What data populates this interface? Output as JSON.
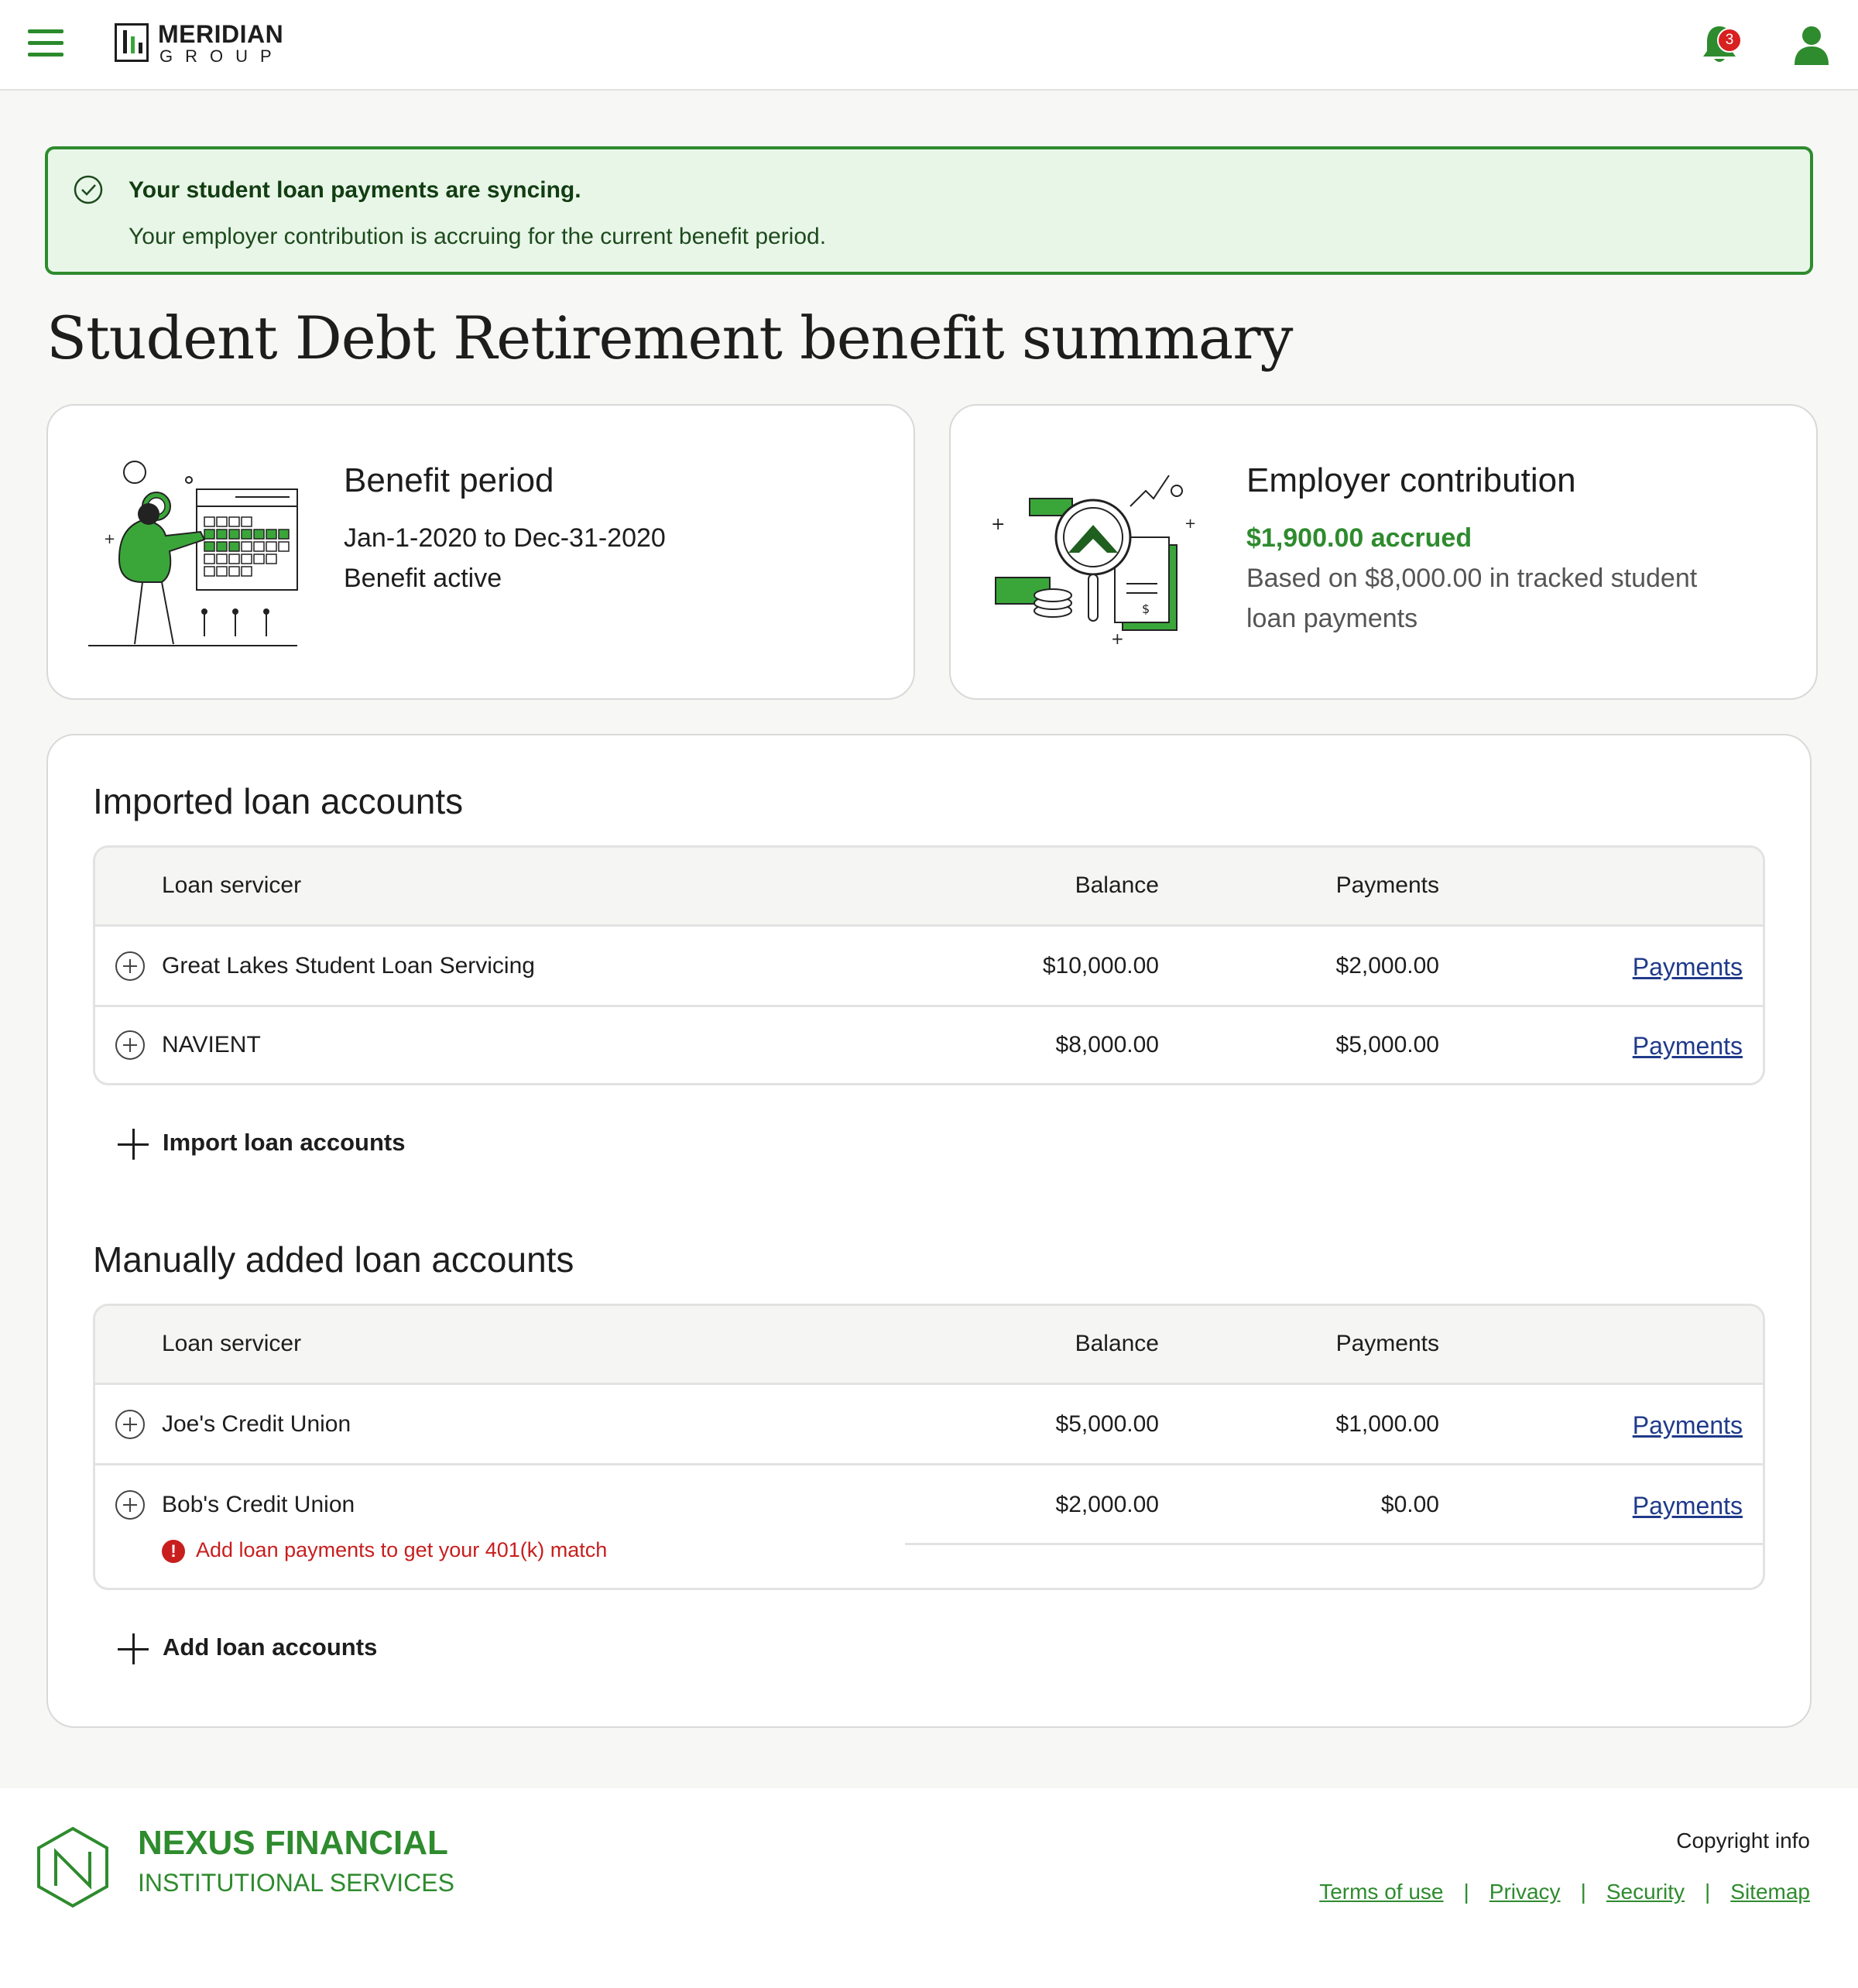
{
  "header": {
    "menu_icon": "hamburger-menu-icon",
    "brand_name": "MERIDIAN",
    "brand_sub": "GROUP",
    "notification_count": "3",
    "notification_icon": "bell-icon",
    "user_icon": "user-icon"
  },
  "alert": {
    "icon": "check-circle-icon",
    "title": "Your student loan payments are syncing.",
    "body": "Your employer contribution is accruing for the current benefit period."
  },
  "page_title": "Student Debt Retirement benefit summary",
  "benefit_card": {
    "title": "Benefit period",
    "period": "Jan-1-2020 to Dec-31-2020",
    "status": "Benefit active"
  },
  "contribution_card": {
    "title": "Employer contribution",
    "accrued": "$1,900.00 accrued",
    "note_line1": "Based on $8,000.00 in tracked student",
    "note_line2": "loan payments"
  },
  "imported": {
    "title": "Imported loan accounts",
    "columns": [
      "Loan servicer",
      "Balance",
      "Payments"
    ],
    "rows": [
      {
        "servicer": "Great Lakes Student Loan Servicing",
        "balance": "$10,000.00",
        "payments": "$2,000.00",
        "link": "Payments"
      },
      {
        "servicer": "NAVIENT",
        "balance": "$8,000.00",
        "payments": "$5,000.00",
        "link": "Payments"
      }
    ],
    "action": "Import loan accounts"
  },
  "manual": {
    "title": "Manually added loan accounts",
    "columns": [
      "Loan servicer",
      "Balance",
      "Payments"
    ],
    "rows": [
      {
        "servicer": "Joe's Credit Union",
        "balance": "$5,000.00",
        "payments": "$1,000.00",
        "link": "Payments"
      },
      {
        "servicer": "Bob's Credit Union",
        "balance": "$2,000.00",
        "payments": "$0.00",
        "link": "Payments",
        "warning": "Add loan payments to get your 401(k) match"
      }
    ],
    "action": "Add loan accounts"
  },
  "footer": {
    "name": "NEXUS FINANCIAL",
    "sub": "INSTITUTIONAL SERVICES",
    "copyright": "Copyright info",
    "links": [
      "Terms of use",
      "Privacy",
      "Security",
      "Sitemap"
    ],
    "separator": "|"
  },
  "colors": {
    "brand_green": "#2e8b2e",
    "alert_bg": "#e8f6e8",
    "link_blue": "#1f3a8a",
    "warning_red": "#c81e1e"
  }
}
